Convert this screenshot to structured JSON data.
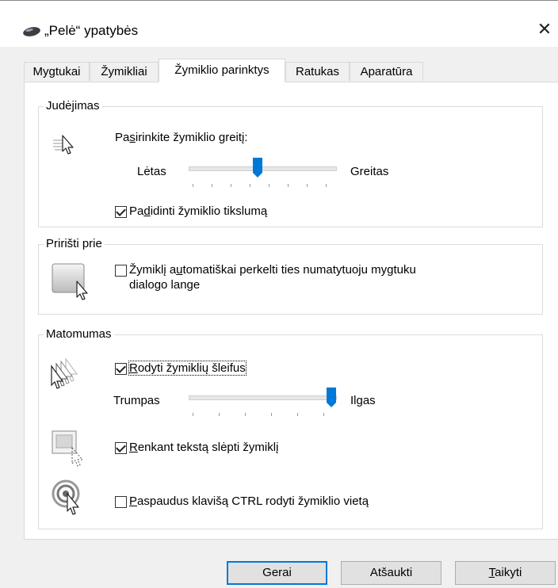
{
  "window": {
    "title": "„Pelė“ ypatybės",
    "close_glyph": "✕"
  },
  "tabs": [
    {
      "label": "Mygtukai",
      "active": false
    },
    {
      "label": "Žymikliai",
      "active": false
    },
    {
      "label": "Žymiklio parinktys",
      "active": true
    },
    {
      "label": "Ratukas",
      "active": false
    },
    {
      "label": "Aparatūra",
      "active": false
    }
  ],
  "motion": {
    "group_label": "Judėjimas",
    "prompt_pre": "Pa",
    "prompt_u": "s",
    "prompt_post": "irinkite žymiklio greitį:",
    "slow_label": "Lėtas",
    "fast_label": "Greitas",
    "speed_fraction": 0.47,
    "precision_pre": "Pa",
    "precision_u": "d",
    "precision_post": "idinti žymiklio tikslumą",
    "precision_checked": true
  },
  "snap": {
    "group_label": "Pririšti prie",
    "line1_pre": "Žymiklį a",
    "line1_u": "u",
    "line1_post": "tomatiškai perkelti ties numatytuoju mygtuku",
    "line2": "dialogo lange",
    "checked": false
  },
  "visibility": {
    "group_label": "Matomumas",
    "trails_u": "R",
    "trails_post": "odyti žymiklių šleifus",
    "trails_checked": true,
    "short_label": "Trumpas",
    "long_label": "Ilgas",
    "trail_fraction": 1.0,
    "hide_u": "R",
    "hide_post": "enkant tekstą slėpti žymiklį",
    "hide_checked": true,
    "ctrl_u": "P",
    "ctrl_post": "aspaudus klavišą CTRL rodyti žymiklio vietą",
    "ctrl_checked": false
  },
  "buttons": {
    "ok": "Gerai",
    "cancel": "Atšaukti",
    "apply_u": "T",
    "apply_post": "aikyti"
  },
  "colors": {
    "accent": "#0078d7"
  }
}
